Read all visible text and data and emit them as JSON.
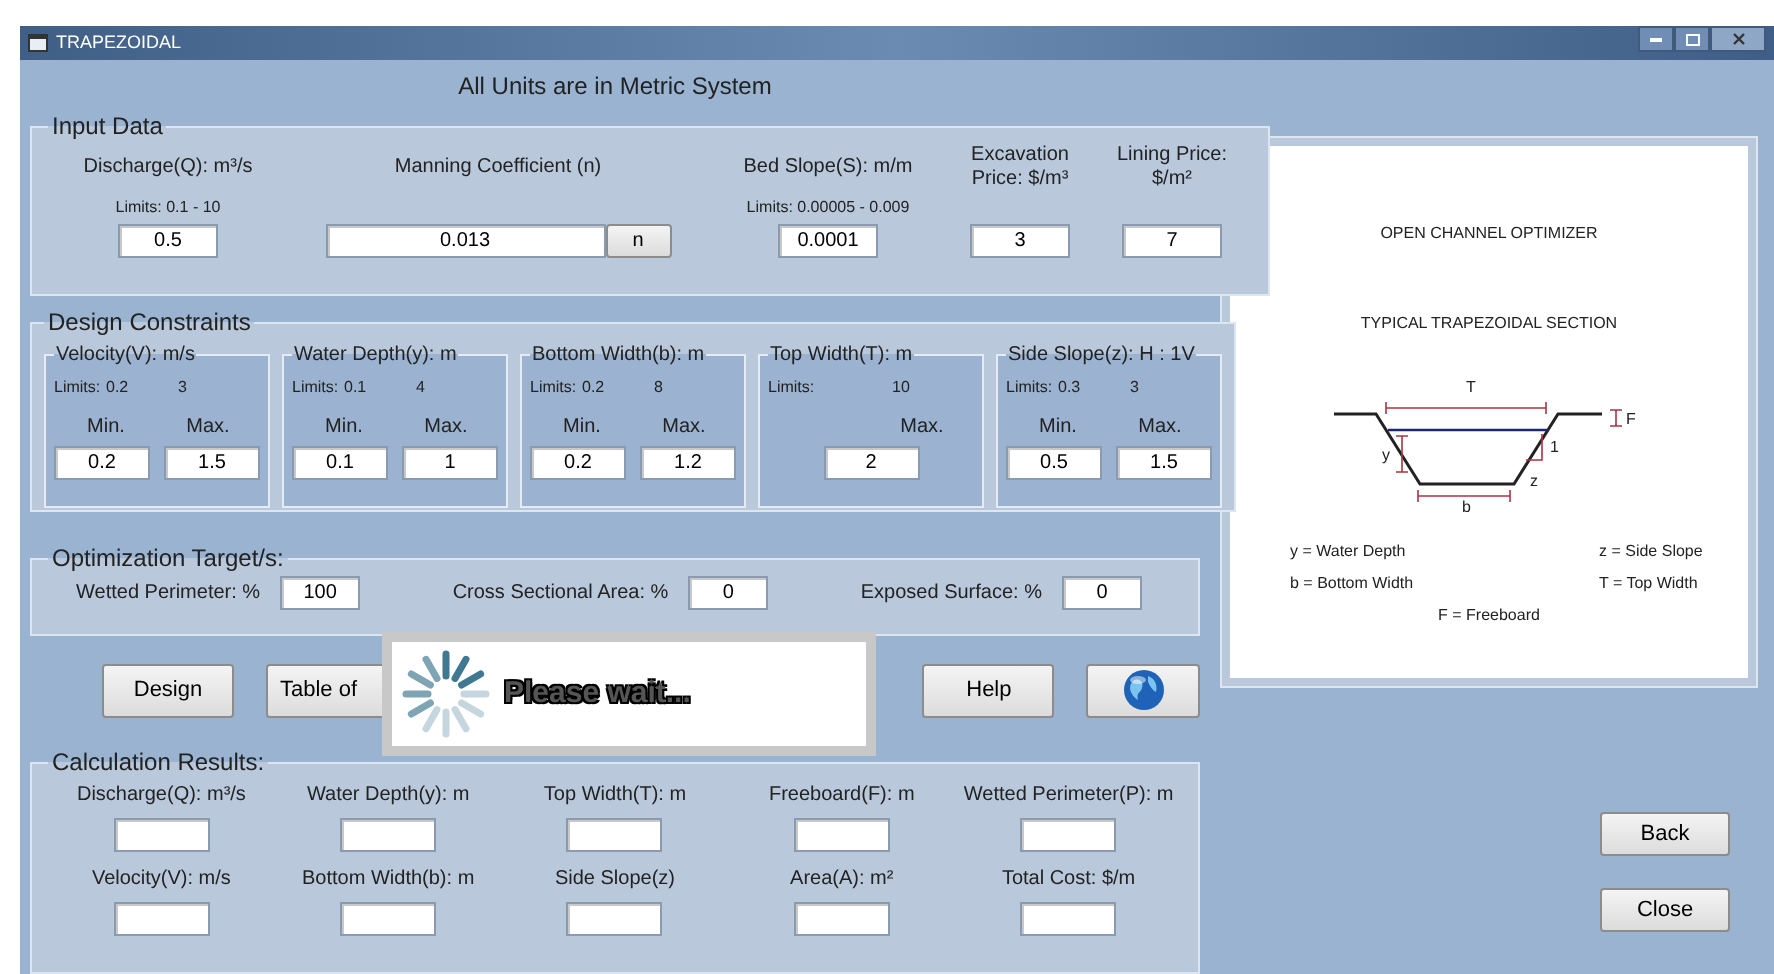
{
  "window": {
    "title": "TRAPEZOIDAL"
  },
  "header": "All Units are in Metric System",
  "input_data": {
    "title": "Input Data",
    "fields": [
      {
        "kind": "plain",
        "label": "Discharge(Q): m³/s",
        "limits": "Limits:  0.1 - 10",
        "value": "0.5"
      },
      {
        "kind": "with_button",
        "label": "Manning Coefficient (n)",
        "value": "0.013",
        "button": "n"
      },
      {
        "kind": "plain",
        "label": "Bed Slope(S): m/m",
        "limits": "Limits:  0.00005 - 0.009",
        "value": "0.0001"
      },
      {
        "kind": "plain",
        "label": "Excavation Price: $/m³",
        "value": "3"
      },
      {
        "kind": "plain",
        "label": "Lining Price: $/m²",
        "value": "7"
      }
    ]
  },
  "design_constraints": {
    "title": "Design Constraints",
    "groups": [
      {
        "title": "Velocity(V): m/s",
        "limits_label": "Limits:",
        "limit_min": "0.2",
        "limit_max": "3",
        "min_label": "Min.",
        "min": "0.2",
        "max_label": "Max.",
        "max": "1.5"
      },
      {
        "title": "Water Depth(y): m",
        "limits_label": "Limits:",
        "limit_min": "0.1",
        "limit_max": "4",
        "min_label": "Min.",
        "min": "0.1",
        "max_label": "Max.",
        "max": "1"
      },
      {
        "title": "Bottom Width(b): m",
        "limits_label": "Limits:",
        "limit_min": "0.2",
        "limit_max": "8",
        "min_label": "Min.",
        "min": "0.2",
        "max_label": "Max.",
        "max": "1.2"
      },
      {
        "title": "Top Width(T): m",
        "limits_label": "Limits:",
        "limit_max": "10",
        "max_label": "Max.",
        "max": "2"
      },
      {
        "title": "Side Slope(z): H : 1V",
        "limits_label": "Limits:",
        "limit_min": "0.3",
        "limit_max": "3",
        "min_label": "Min.",
        "min": "0.5",
        "max_label": "Max.",
        "max": "1.5"
      }
    ]
  },
  "optimization": {
    "title": "Optimization Target/s:",
    "targets": [
      {
        "label": "Wetted Perimeter: %",
        "value": "100"
      },
      {
        "label": "Cross Sectional Area: %",
        "value": "0"
      },
      {
        "label": "Exposed Surface: %",
        "value": "0"
      }
    ]
  },
  "actions": [
    {
      "kind": "text",
      "label": "Design"
    },
    {
      "kind": "text",
      "label": "Table of"
    },
    {
      "kind": "text",
      "label": "Help"
    },
    {
      "kind": "globe"
    }
  ],
  "popup": {
    "message": "Please wait..."
  },
  "results": {
    "title": "Calculation Results:",
    "fields": [
      {
        "label": "Discharge(Q): m³/s"
      },
      {
        "label": "Water Depth(y): m"
      },
      {
        "label": "Top Width(T): m"
      },
      {
        "label": "Freeboard(F): m"
      },
      {
        "label": "Wetted Perimeter(P): m"
      },
      {
        "label": "Velocity(V): m/s"
      },
      {
        "label": "Bottom Width(b): m"
      },
      {
        "label": "Side Slope(z)"
      },
      {
        "label": "Area(A): m²"
      },
      {
        "label": "Total Cost: $/m"
      }
    ]
  },
  "diagram": {
    "title": "OPEN CHANNEL OPTIMIZER",
    "subtitle": "TYPICAL TRAPEZOIDAL SECTION",
    "labels": {
      "top": "T",
      "freeboard": "F",
      "depth": "y",
      "rise": "1",
      "slope": "z",
      "bottom": "b"
    },
    "legend": [
      "y = Water Depth",
      "z = Side Slope",
      "b = Bottom Width",
      "T = Top Width",
      "F = Freeboard"
    ]
  },
  "nav_buttons": [
    "Back",
    "Close"
  ]
}
